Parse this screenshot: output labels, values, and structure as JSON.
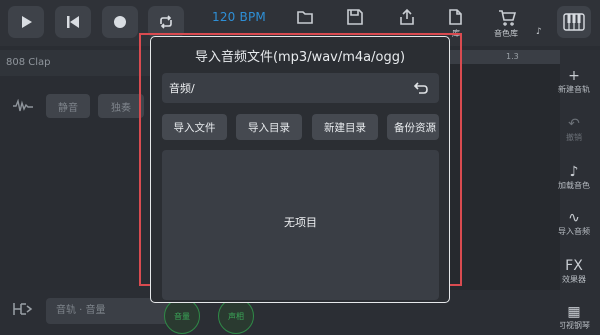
{
  "toolbar": {
    "bpm": "120 BPM",
    "library_label": "音色库",
    "truncated_label": "库",
    "more_mark": "♪"
  },
  "track": {
    "name": "808 Clap",
    "mute_label": "静音",
    "solo_label": "独奏"
  },
  "timeline": {
    "marker": "1.3"
  },
  "sidebar": {
    "items": [
      {
        "label": "新建音轨",
        "icon": "plus-icon",
        "glyph": "+"
      },
      {
        "label": "撤销",
        "icon": "undo-icon",
        "glyph": "↶"
      },
      {
        "label": "加载音色",
        "icon": "note-icon",
        "glyph": "♪"
      },
      {
        "label": "导入音频",
        "icon": "waveform-icon",
        "glyph": "∿"
      },
      {
        "label": "效果器",
        "icon": "fx-icon",
        "glyph": "FX"
      },
      {
        "label": "可视钢琴",
        "icon": "piano-icon",
        "glyph": "▦"
      }
    ]
  },
  "bottom": {
    "input_text": "音轨 · 音量",
    "btn1_label": "音量",
    "btn2_label": "声相"
  },
  "dialog": {
    "title": "导入音频文件(mp3/wav/m4a/ogg)",
    "path": "音频/",
    "buttons": [
      "导入文件",
      "导入目录",
      "新建目录",
      "备份资源"
    ],
    "empty_text": "无项目"
  },
  "colors": {
    "accent_blue": "#2e8fd6",
    "highlight_red": "#d94b50",
    "green": "#3aa657"
  }
}
